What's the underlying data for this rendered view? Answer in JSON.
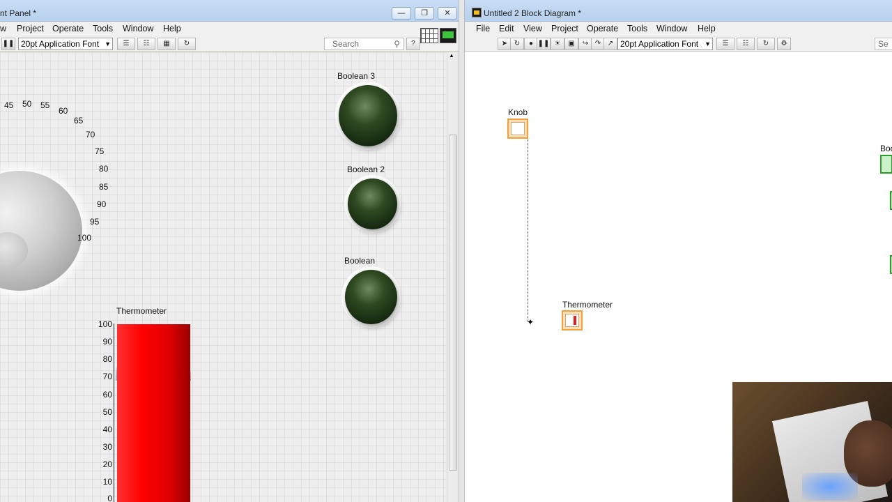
{
  "front_panel": {
    "title": "nt Panel *",
    "menu": [
      "w",
      "Project",
      "Operate",
      "Tools",
      "Window",
      "Help"
    ],
    "font_ring": "20pt Application Font",
    "search_placeholder": "Search",
    "controls": {
      "knob": {
        "tick_labels": [
          "45",
          "50",
          "55",
          "60",
          "65",
          "70",
          "75",
          "80",
          "85",
          "90",
          "95",
          "100"
        ]
      },
      "boolean3_label": "Boolean 3",
      "boolean2_label": "Boolean 2",
      "boolean_label": "Boolean",
      "thermometer": {
        "label": "Thermometer",
        "scale": [
          "100",
          "90",
          "80",
          "70",
          "60",
          "50",
          "40",
          "30",
          "20",
          "10",
          "0"
        ],
        "value": 100
      }
    },
    "window_buttons": [
      "minimize",
      "restore",
      "close"
    ]
  },
  "block_diagram": {
    "title": "Untitled 2 Block Diagram *",
    "menu": [
      "File",
      "Edit",
      "View",
      "Project",
      "Operate",
      "Tools",
      "Window",
      "Help"
    ],
    "font_ring": "20pt Application Font",
    "search_placeholder": "Se",
    "terminals": {
      "knob_label": "Knob",
      "thermometer_label": "Thermometer",
      "boolean_label_partial": "Boo"
    }
  },
  "colors": {
    "led_off": "#1f3618",
    "thermometer_fill": "#ff0000",
    "terminal_orange": "#f0a040",
    "terminal_green": "#2aa02a"
  }
}
